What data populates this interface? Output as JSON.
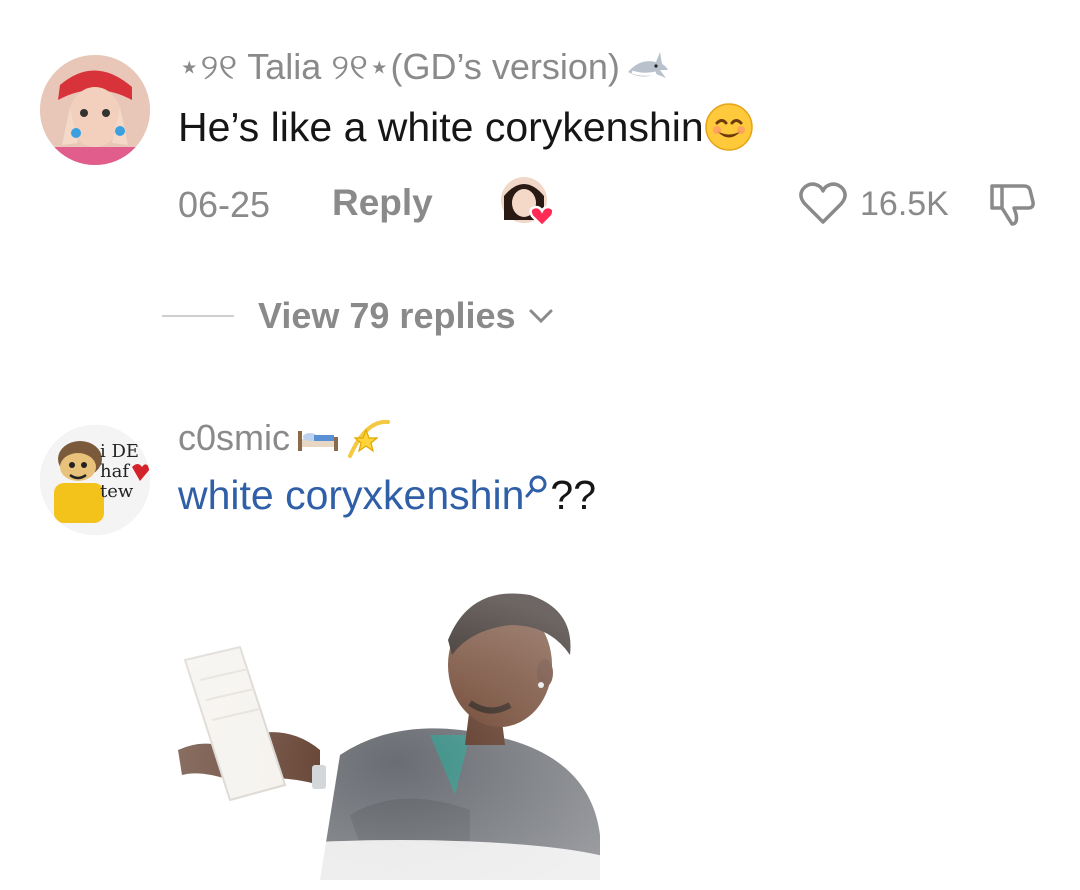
{
  "comments": [
    {
      "username": "⋆୨୧ Talia ୨୧⋆(GD’s version)",
      "username_emoji": "shark-emoji",
      "text": "He’s like a white corykenshin",
      "text_emoji": "relieved-smile-emoji",
      "date": "06-25",
      "reply_label": "Reply",
      "likes": "16.5K",
      "view_replies_label": "View 79 replies"
    },
    {
      "username": "c0smic",
      "username_emoji": "bed-and-dizzy-emoji",
      "search_text": "white coryxkenshin",
      "text_suffix": "??",
      "sticker": "man-reading-paper-sticker"
    }
  ],
  "colors": {
    "muted": "#8a8a8a",
    "link": "#2f5fa7",
    "heart": "#ff2b55"
  }
}
